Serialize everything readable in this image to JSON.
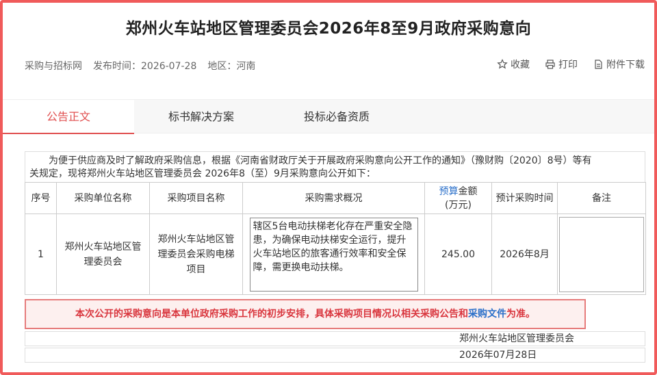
{
  "page": {
    "title": "郑州火车站地区管理委员会2026年8至9月政府采购意向"
  },
  "meta": {
    "source": "采购与招标网",
    "publish_label": "发布时间：2026-07-28",
    "region_label": "地区：河南"
  },
  "actions": {
    "favorite": "收藏",
    "print": "打印",
    "download": "附件下载"
  },
  "tabs": [
    {
      "label": "公告正文",
      "active": true
    },
    {
      "label": "标书解决方案",
      "active": false
    },
    {
      "label": "投标必备资质",
      "active": false
    }
  ],
  "intro": {
    "line1": "为便于供应商及时了解政府采购信息，根据《河南省财政厅关于开展政府采购意向公开工作的通知》（豫财购〔2020〕8号）等有",
    "line2": "关规定，现将郑州火车站地区管理委员会 2026年8（至）9月采购意向公开如下："
  },
  "table": {
    "headers": {
      "no": "序号",
      "unit": "采购单位名称",
      "project": "采购项目名称",
      "summary": "采购需求概况",
      "budget_link": "预算",
      "budget_rest": "金额",
      "budget_unit": "(万元)",
      "time": "预计采购时间",
      "remark": "备注"
    },
    "rows": [
      {
        "no": "1",
        "unit": "郑州火车站地区管理委员会",
        "project": "郑州火车站地区管理委员会采购电梯项目",
        "summary": "辖区5台电动扶梯老化存在严重安全隐患，为确保电动扶梯安全运行，提升火车站地区的旅客通行效率和安全保障，需更换电动扶梯。",
        "budget": "245.00",
        "time": "2026年8月",
        "remark": ""
      }
    ]
  },
  "notice": {
    "text_before": "本次公开的采购意向是本单位政府采购工作的初步安排，具体采购项目情况以相关采购公告和",
    "link": "采购文件",
    "text_after": "为准。"
  },
  "footer": {
    "org": "郑州火车站地区管理委员会",
    "date": "2026年07月28日"
  },
  "colors": {
    "accent": "#e04f4f",
    "link": "#2a6fc9",
    "frame": "#f05a5a"
  }
}
